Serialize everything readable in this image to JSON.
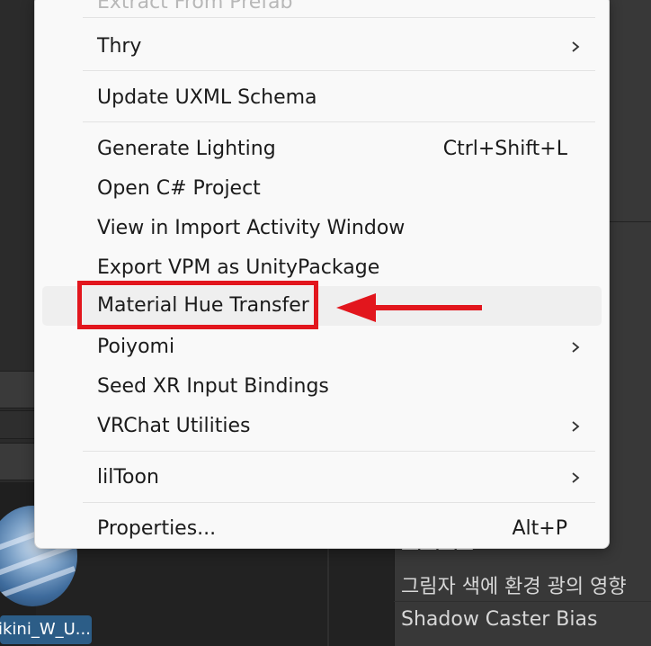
{
  "menu": {
    "items": [
      {
        "key": "extract_from_prefab",
        "label": "Extract From Prefab",
        "shortcut": "",
        "submenu": false,
        "state": "ghost"
      },
      {
        "key": "thry",
        "label": "Thry",
        "shortcut": "",
        "submenu": true
      },
      {
        "key": "update_uxml_schema",
        "label": "Update UXML Schema",
        "shortcut": "",
        "submenu": false
      },
      {
        "key": "generate_lighting",
        "label": "Generate Lighting",
        "shortcut": "Ctrl+Shift+L",
        "submenu": false
      },
      {
        "key": "open_csharp_project",
        "label": "Open C# Project",
        "shortcut": "",
        "submenu": false
      },
      {
        "key": "view_in_import_activity_window",
        "label": "View in Import Activity Window",
        "shortcut": "",
        "submenu": false
      },
      {
        "key": "export_vpm_as_unitypackage",
        "label": "Export VPM as UnityPackage",
        "shortcut": "",
        "submenu": false
      },
      {
        "key": "material_hue_transfer",
        "label": "Material Hue Transfer",
        "shortcut": "",
        "submenu": false,
        "state": "hovered"
      },
      {
        "key": "poiyomi",
        "label": "Poiyomi",
        "shortcut": "",
        "submenu": true
      },
      {
        "key": "seed_xr_input_bindings",
        "label": "Seed XR Input Bindings",
        "shortcut": "",
        "submenu": false
      },
      {
        "key": "vrchat_utilities",
        "label": "VRChat Utilities",
        "shortcut": "",
        "submenu": true
      },
      {
        "key": "liltoon",
        "label": "lilToon",
        "shortcut": "",
        "submenu": true
      },
      {
        "key": "properties",
        "label": "Properties...",
        "shortcut": "Alt+P",
        "submenu": false
      }
    ]
  },
  "project": {
    "asset_label": "ikini_W_U..."
  },
  "inspector": {
    "partial_label": "ㅡㅡㅡㅡ",
    "shadow_env_label": "그림자 색에 환경 광의 영향",
    "shadow_caster_bias_label": "Shadow Caster Bias"
  },
  "annotation": {
    "highlight_color": "#e2161d",
    "target": "Material Hue Transfer"
  },
  "colors": {
    "menu_bg": "#f9f9f9",
    "menu_text": "#1b1b1b",
    "hover_bg": "#efefef",
    "editor_bg": "#383838",
    "selection_blue": "#2c5d87"
  }
}
